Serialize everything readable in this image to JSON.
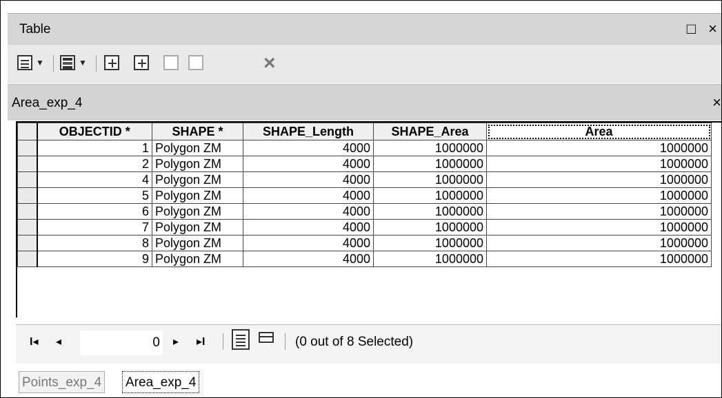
{
  "window": {
    "title": "Table",
    "controls": "□ ×"
  },
  "toolbar": {
    "icons": [
      "table-options-icon",
      "related-tables-icon",
      "select-by-attributes-icon",
      "switch-selection-icon",
      "clear-selection-icon",
      "zoom-to-selected-icon",
      "delete-selected-icon"
    ],
    "delete_glyph": "×"
  },
  "layer": {
    "name": "Area_exp_4",
    "close_glyph": "×"
  },
  "table": {
    "columns": [
      "OBJECTID *",
      "SHAPE *",
      "SHAPE_Length",
      "SHAPE_Area",
      "Area"
    ],
    "rows": [
      {
        "objectid": "1",
        "shape": "Polygon ZM",
        "length": "4000",
        "shape_area": "1000000",
        "area": "1000000"
      },
      {
        "objectid": "2",
        "shape": "Polygon ZM",
        "length": "4000",
        "shape_area": "1000000",
        "area": "1000000"
      },
      {
        "objectid": "4",
        "shape": "Polygon ZM",
        "length": "4000",
        "shape_area": "1000000",
        "area": "1000000"
      },
      {
        "objectid": "5",
        "shape": "Polygon ZM",
        "length": "4000",
        "shape_area": "1000000",
        "area": "1000000"
      },
      {
        "objectid": "6",
        "shape": "Polygon ZM",
        "length": "4000",
        "shape_area": "1000000",
        "area": "1000000"
      },
      {
        "objectid": "7",
        "shape": "Polygon ZM",
        "length": "4000",
        "shape_area": "1000000",
        "area": "1000000"
      },
      {
        "objectid": "8",
        "shape": "Polygon ZM",
        "length": "4000",
        "shape_area": "1000000",
        "area": "1000000"
      },
      {
        "objectid": "9",
        "shape": "Polygon ZM",
        "length": "4000",
        "shape_area": "1000000",
        "area": "1000000"
      }
    ]
  },
  "navigation": {
    "first_glyph": "I◂",
    "prev_glyph": "◂",
    "current_record": "0",
    "next_glyph": "▸",
    "last_glyph": "▸I",
    "status": "(0 out of 8 Selected)"
  },
  "tabs": [
    {
      "label": "Points_exp_4",
      "active": false
    },
    {
      "label": "Area_exp_4",
      "active": true
    }
  ]
}
